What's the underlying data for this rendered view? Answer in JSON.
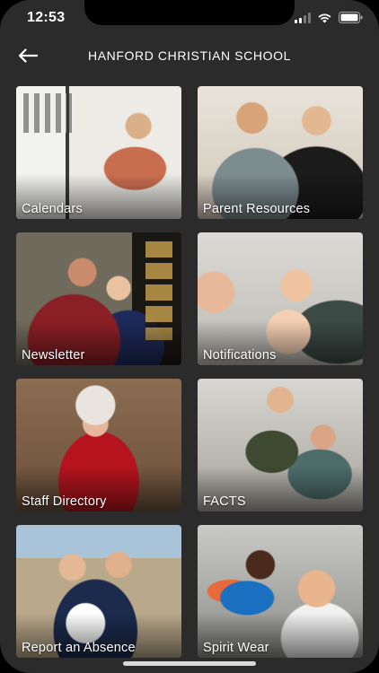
{
  "status_bar": {
    "time": "12:53"
  },
  "header": {
    "title": "HANFORD CHRISTIAN SCHOOL",
    "back_icon": "arrow-left-icon"
  },
  "tiles": [
    {
      "label": "Calendars"
    },
    {
      "label": "Parent Resources"
    },
    {
      "label": "Newsletter"
    },
    {
      "label": "Notifications"
    },
    {
      "label": "Staff Directory"
    },
    {
      "label": "FACTS"
    },
    {
      "label": "Report an Absence"
    },
    {
      "label": "Spirit Wear"
    }
  ],
  "colors": {
    "background": "#2b2b2b",
    "text": "#ffffff"
  }
}
